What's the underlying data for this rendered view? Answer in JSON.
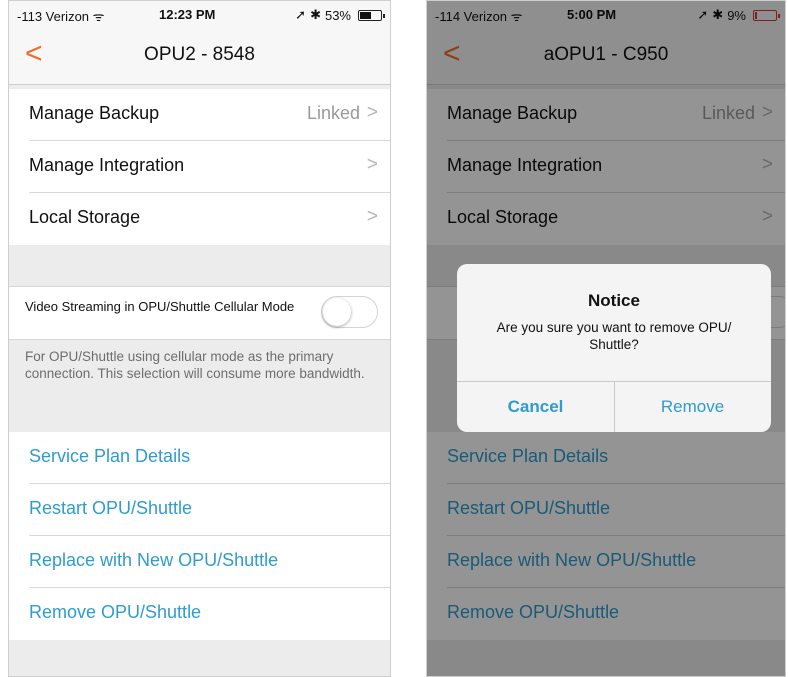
{
  "left": {
    "status": {
      "carrier": "-113 Verizon",
      "time": "12:23 PM",
      "battery": "53%",
      "battery_level": 0.53
    },
    "nav": {
      "title": "OPU2 - 8548"
    },
    "manage_backup": {
      "label": "Manage Backup",
      "value": "Linked"
    },
    "manage_integration": "Manage Integration",
    "local_storage": "Local Storage",
    "video_toggle": {
      "label": "Video Streaming in OPU/Shuttle Cellular Mode",
      "on": false
    },
    "footnote": "For OPU/Shuttle using cellular mode as the primary connection. This selection will consume more bandwidth.",
    "actions": [
      "Service Plan Details",
      "Restart OPU/Shuttle",
      "Replace with New OPU/Shuttle",
      "Remove OPU/Shuttle"
    ]
  },
  "right": {
    "status": {
      "carrier": "-114 Verizon",
      "time": "5:00 PM",
      "battery": "9%",
      "battery_level": 0.09
    },
    "nav": {
      "title": "aOPU1 - C950"
    },
    "manage_backup": {
      "label": "Manage Backup",
      "value": "Linked"
    },
    "manage_integration": "Manage Integration",
    "local_storage": "Local Storage",
    "actions": [
      "Service Plan Details",
      "Restart OPU/Shuttle",
      "Replace with New OPU/Shuttle",
      "Remove OPU/Shuttle"
    ],
    "alert": {
      "title": "Notice",
      "message": "Are you sure you want to remove OPU/ Shuttle?",
      "cancel": "Cancel",
      "remove": "Remove"
    }
  },
  "colors": {
    "accent_orange": "#ef6b2a",
    "link_blue": "#2f9ccd",
    "battery_low": "#d33333"
  }
}
